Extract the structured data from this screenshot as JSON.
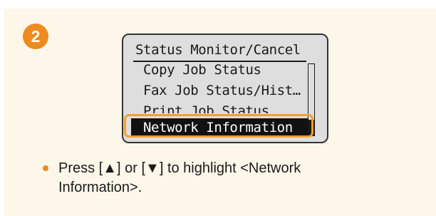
{
  "step": {
    "number": "2",
    "badge_color": "#ee8a1e"
  },
  "lcd": {
    "title": "Status Monitor/Cancel",
    "items": [
      "Copy Job Status",
      "Fax Job Status/Hist…",
      "Print Job Status",
      "Network Information"
    ],
    "selected_index": 3,
    "highlight_color": "#f0a030"
  },
  "instruction": {
    "text": "Press [▲] or [▼] to highlight <Network Information>.",
    "bullet_color": "#ee8a1e"
  }
}
